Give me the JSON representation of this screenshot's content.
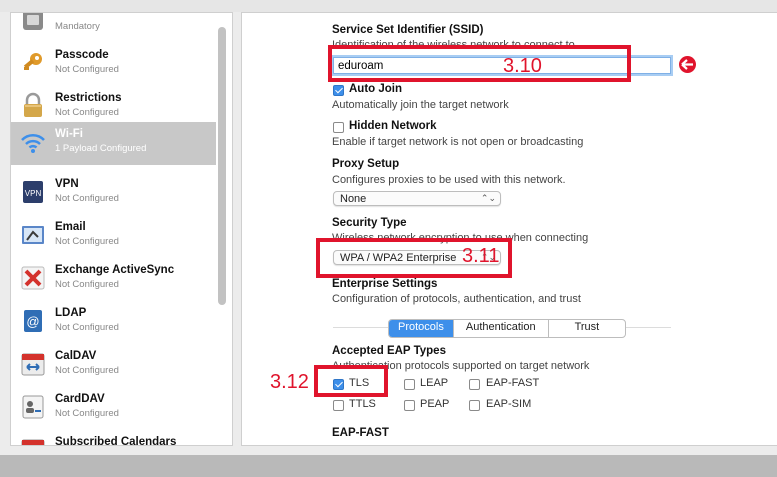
{
  "sidebar": {
    "items": [
      {
        "title": "",
        "sub": "Mandatory",
        "icon": "general-icon"
      },
      {
        "title": "Passcode",
        "sub": "Not Configured",
        "icon": "key-icon"
      },
      {
        "title": "Restrictions",
        "sub": "Not Configured",
        "icon": "lock-icon"
      },
      {
        "title": "Wi-Fi",
        "sub": "1 Payload Configured",
        "icon": "wifi-icon"
      },
      {
        "title": "VPN",
        "sub": "Not Configured",
        "icon": "vpn-icon"
      },
      {
        "title": "Email",
        "sub": "Not Configured",
        "icon": "email-icon"
      },
      {
        "title": "Exchange ActiveSync",
        "sub": "Not Configured",
        "icon": "exchange-icon"
      },
      {
        "title": "LDAP",
        "sub": "Not Configured",
        "icon": "ldap-icon"
      },
      {
        "title": "CalDAV",
        "sub": "Not Configured",
        "icon": "calendar-icon"
      },
      {
        "title": "CardDAV",
        "sub": "Not Configured",
        "icon": "contacts-icon"
      },
      {
        "title": "Subscribed Calendars",
        "sub": "",
        "icon": "calendar-icon"
      }
    ],
    "selected_color": "#c8c8c8"
  },
  "wifi": {
    "ssid": {
      "label": "Service Set Identifier (SSID)",
      "desc": "Identification of the wireless network to connect to",
      "value": "eduroam"
    },
    "auto_join": {
      "label": "Auto Join",
      "desc": "Automatically join the target network",
      "checked": true
    },
    "hidden_network": {
      "label": "Hidden Network",
      "desc": "Enable if target network is not open or broadcasting",
      "checked": false
    },
    "proxy": {
      "label": "Proxy Setup",
      "desc": "Configures proxies to be used with this network.",
      "value": "None"
    },
    "security": {
      "label": "Security Type",
      "desc": "Wireless network encryption to use when connecting",
      "value": "WPA / WPA2 Enterprise"
    },
    "enterprise": {
      "label": "Enterprise Settings",
      "desc": "Configuration of protocols, authentication, and trust",
      "tabs": [
        "Protocols",
        "Authentication",
        "Trust"
      ],
      "active_tab": "Protocols"
    },
    "eap": {
      "label": "Accepted EAP Types",
      "desc": "Authentication protocols supported on target network",
      "types": [
        {
          "name": "TLS",
          "checked": true
        },
        {
          "name": "LEAP",
          "checked": false
        },
        {
          "name": "EAP-FAST",
          "checked": false
        },
        {
          "name": "TTLS",
          "checked": false
        },
        {
          "name": "PEAP",
          "checked": false
        },
        {
          "name": "EAP-SIM",
          "checked": false
        }
      ]
    },
    "eap_fast": {
      "label": "EAP-FAST"
    }
  },
  "annotations": {
    "ssid_step": "3.10",
    "security_step": "3.11",
    "eap_step": "3.12",
    "color": "#e0142c"
  }
}
